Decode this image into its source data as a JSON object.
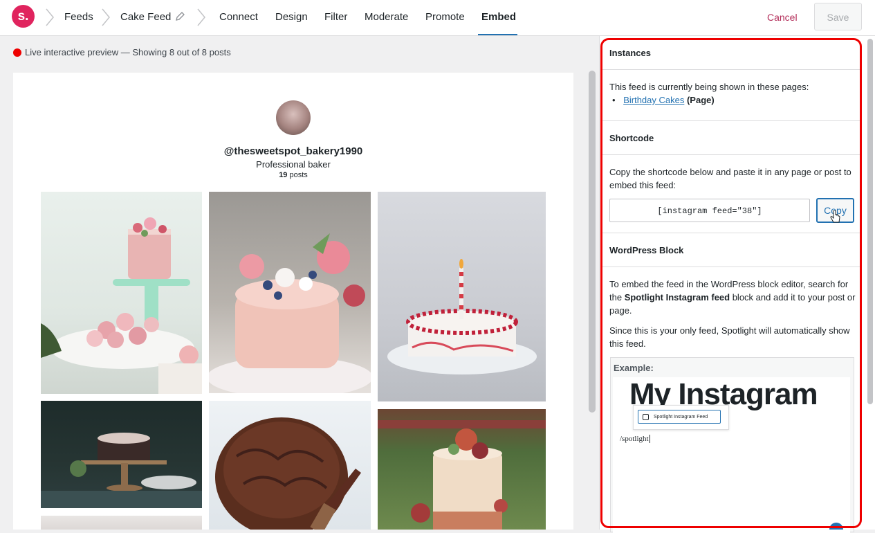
{
  "nav": {
    "logo": "s.",
    "breadcrumbs": [
      "Feeds",
      "Cake Feed"
    ],
    "tabs": [
      "Connect",
      "Design",
      "Filter",
      "Moderate",
      "Promote",
      "Embed"
    ],
    "active_tab": "Embed",
    "cancel": "Cancel",
    "save": "Save"
  },
  "preview": {
    "status": "Live interactive preview — Showing 8 out of 8 posts",
    "username": "@thesweetspot_bakery1990",
    "bio": "Professional baker",
    "posts_count": "19",
    "posts_label": "posts"
  },
  "panel": {
    "instances": {
      "title": "Instances",
      "text": "This feed is currently being shown in these pages:",
      "page_link": "Birthday Cakes",
      "page_type": "(Page)"
    },
    "shortcode": {
      "title": "Shortcode",
      "text": "Copy the shortcode below and paste it in any page or post to embed this feed:",
      "value": "[instagram feed=\"38\"]",
      "copy": "Copy"
    },
    "block": {
      "title": "WordPress Block",
      "text_before": "To embed the feed in the WordPress block editor, search for the ",
      "text_bold": "Spotlight Instagram feed",
      "text_after": " block and add it to your post or page.",
      "text2": "Since this is your only feed, Spotlight will automatically show this feed.",
      "example_label": "Example:",
      "example_title": "My Instagram",
      "example_item": "Spotlight Instagram Feed",
      "example_command": "/spotlight"
    }
  },
  "colors": {
    "brand": "#e0245e",
    "accent": "#2271b1",
    "highlight": "#e00000"
  }
}
